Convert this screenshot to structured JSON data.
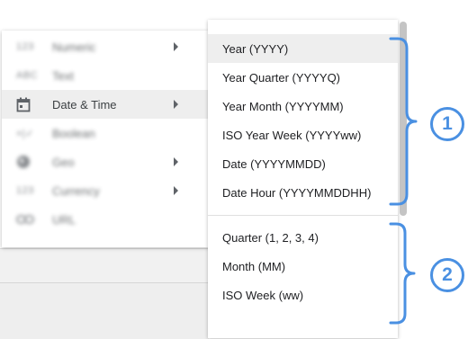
{
  "left_menu": {
    "items": [
      {
        "icon": "123",
        "icon_name": "numeric-icon",
        "label": "Numeric",
        "has_submenu": true
      },
      {
        "icon": "ABC",
        "icon_name": "text-icon",
        "label": "Text",
        "has_submenu": false
      },
      {
        "icon": "",
        "icon_name": "calendar-icon",
        "label": "Date & Time",
        "has_submenu": true
      },
      {
        "icon": "×|✓",
        "icon_name": "boolean-icon",
        "label": "Boolean",
        "has_submenu": false
      },
      {
        "icon": "",
        "icon_name": "globe-icon",
        "label": "Geo",
        "has_submenu": true
      },
      {
        "icon": "123",
        "icon_name": "currency-icon",
        "label": "Currency",
        "has_submenu": true
      },
      {
        "icon": "",
        "icon_name": "link-icon",
        "label": "URL",
        "has_submenu": false
      }
    ]
  },
  "submenu": {
    "group1": [
      "Year (YYYY)",
      "Year Quarter (YYYYQ)",
      "Year Month (YYYYMM)",
      "ISO Year Week (YYYYww)",
      "Date (YYYYMMDD)",
      "Date Hour (YYYYMMDDHH)"
    ],
    "group2": [
      "Quarter (1, 2, 3, 4)",
      "Month (MM)",
      "ISO Week (ww)"
    ]
  },
  "annotations": {
    "badge1": "1",
    "badge2": "2"
  },
  "colors": {
    "accent": "#4a90e2",
    "hover": "#eeeeee"
  }
}
